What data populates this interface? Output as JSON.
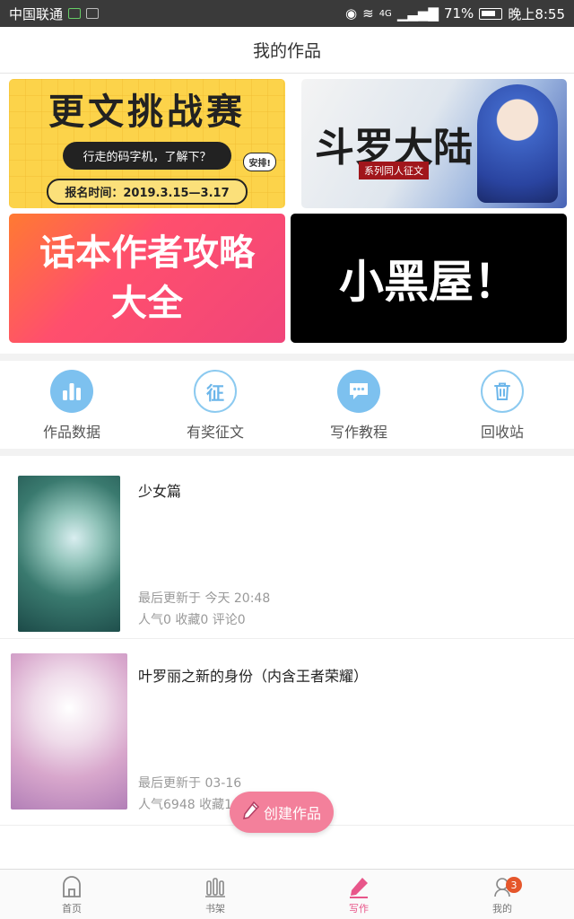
{
  "status_bar": {
    "carrier": "中国联通",
    "signal": "4G",
    "battery": "71%",
    "time": "晚上8:55"
  },
  "header": {
    "title": "我的作品"
  },
  "banners": {
    "challenge": {
      "title": "更文挑战赛",
      "subtitle": "行走的码字机，了解下？",
      "date": "报名时间：2019.3.15—3.17",
      "tag": "安排!"
    },
    "douluo": {
      "title": "斗罗大陆",
      "subtitle": "系列同人征文"
    },
    "guide": {
      "line1": "话本作者攻略",
      "line2": "大全"
    },
    "blackroom": {
      "title": "小黑屋！"
    }
  },
  "actions": [
    {
      "label": "作品数据",
      "icon": "bar-chart-icon"
    },
    {
      "label": "有奖征文",
      "icon": "contest-icon",
      "glyph": "征"
    },
    {
      "label": "写作教程",
      "icon": "chat-bubble-icon"
    },
    {
      "label": "回收站",
      "icon": "trash-icon"
    }
  ],
  "works": [
    {
      "title": "少女篇",
      "updated": "最后更新于 今天 20:48",
      "stats": "人气0 收藏0 评论0"
    },
    {
      "title": "叶罗丽之新的身份（内含王者荣耀）",
      "updated": "最后更新于 03-16",
      "stats": "人气6948 收藏1"
    }
  ],
  "fab": {
    "label": "创建作品"
  },
  "nav": [
    {
      "label": "首页",
      "icon": "home-icon"
    },
    {
      "label": "书架",
      "icon": "bookshelf-icon"
    },
    {
      "label": "写作",
      "icon": "pencil-icon",
      "active": true
    },
    {
      "label": "我的",
      "icon": "profile-icon",
      "badge": "3"
    }
  ],
  "colors": {
    "accent_pink": "#e8568a",
    "fab_pink": "#f3809b",
    "action_blue": "#7dc1ef",
    "badge_orange": "#e5562b"
  }
}
